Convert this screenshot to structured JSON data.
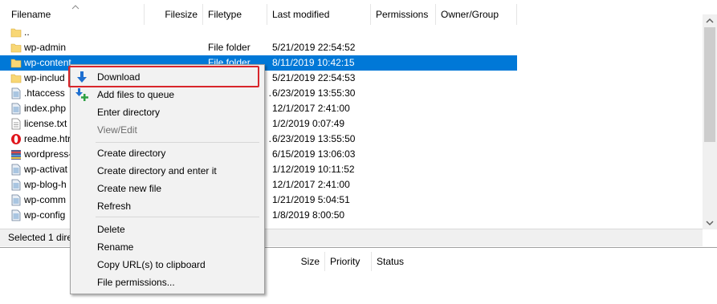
{
  "file_list": {
    "columns": {
      "filename": "Filename",
      "filesize": "Filesize",
      "filetype": "Filetype",
      "last_modified": "Last modified",
      "permissions": "Permissions",
      "owner_group": "Owner/Group"
    },
    "rows": [
      {
        "name": "..",
        "icon": "folder-icon",
        "size": "",
        "type": "",
        "modified": ""
      },
      {
        "name": "wp-admin",
        "icon": "folder-icon",
        "size": "",
        "type": "File folder",
        "modified": "5/21/2019 22:54:52"
      },
      {
        "name": "wp-content",
        "icon": "folder-icon",
        "size": "",
        "type": "File folder",
        "modified": "8/11/2019 10:42:15",
        "selected": true
      },
      {
        "name": "wp-includ",
        "icon": "folder-icon",
        "size": "",
        "type": "",
        "modified": "5/21/2019 22:54:53"
      },
      {
        "name": ".htaccess",
        "icon": "file-icon",
        "size": ".",
        "type": "",
        "modified": "6/23/2019 13:55:30"
      },
      {
        "name": "index.php",
        "icon": "file-icon",
        "size": "",
        "type": "",
        "modified": "12/1/2017 2:41:00"
      },
      {
        "name": "license.txt",
        "icon": "text-file-icon",
        "size": "",
        "type": "",
        "modified": "1/2/2019 0:07:49"
      },
      {
        "name": "readme.htr",
        "icon": "opera-icon",
        "size": ".",
        "type": "",
        "modified": "6/23/2019 13:55:50"
      },
      {
        "name": "wordpress-",
        "icon": "archive-icon",
        "size": "",
        "type": "",
        "modified": "6/15/2019 13:06:03"
      },
      {
        "name": "wp-activat",
        "icon": "file-icon",
        "size": "",
        "type": "",
        "modified": "1/12/2019 10:11:52"
      },
      {
        "name": "wp-blog-h",
        "icon": "file-icon",
        "size": "",
        "type": "",
        "modified": "12/1/2017 2:41:00"
      },
      {
        "name": "wp-comm",
        "icon": "file-icon",
        "size": "",
        "type": "",
        "modified": "1/21/2019 5:04:51"
      },
      {
        "name": "wp-config",
        "icon": "file-icon",
        "size": "",
        "type": "",
        "modified": "1/8/2019 8:00:50"
      }
    ],
    "status": "Selected 1 dire"
  },
  "queue": {
    "columns": {
      "size": "Size",
      "priority": "Priority",
      "status": "Status"
    }
  },
  "context_menu": {
    "items": [
      {
        "label": "Download",
        "icon": "download-arrow-icon",
        "disabled": false
      },
      {
        "label": "Add files to queue",
        "icon": "add-to-queue-icon",
        "disabled": false
      },
      {
        "label": "Enter directory",
        "disabled": false
      },
      {
        "label": "View/Edit",
        "disabled": true
      },
      {
        "label": "Create directory",
        "disabled": false
      },
      {
        "label": "Create directory and enter it",
        "disabled": false
      },
      {
        "label": "Create new file",
        "disabled": false
      },
      {
        "label": "Refresh",
        "disabled": false
      },
      {
        "label": "Delete",
        "disabled": false
      },
      {
        "label": "Rename",
        "disabled": false
      },
      {
        "label": "Copy URL(s) to clipboard",
        "disabled": false
      },
      {
        "label": "File permissions...",
        "disabled": false
      }
    ]
  },
  "colors": {
    "selection": "#0078d7",
    "highlight_box": "#d8252b",
    "folder": "#f8d775",
    "download_arrow": "#1e6fd0",
    "add_plus": "#2ea043"
  }
}
